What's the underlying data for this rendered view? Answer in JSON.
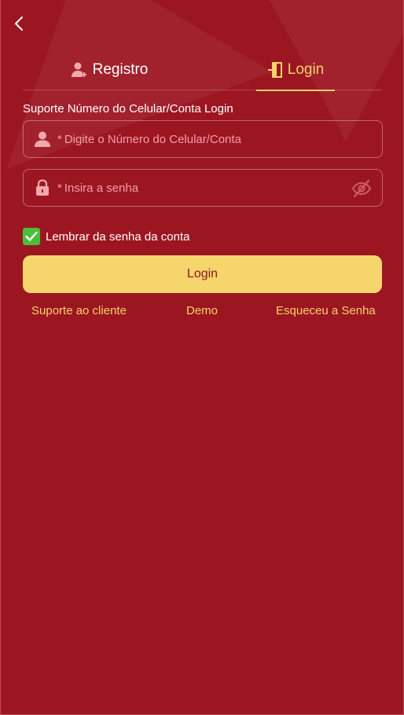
{
  "tabs": {
    "register_label": "Registro",
    "login_label": "Login"
  },
  "form": {
    "account_label": "Suporte Número do Celular/Conta Login",
    "required_mark": "*",
    "phone_placeholder": "Digite o Número do Celular/Conta",
    "password_placeholder": "Insira a senha",
    "remember_label": "Lembrar da senha da conta",
    "remember_checked": true,
    "submit_label": "Login"
  },
  "links": {
    "support": "Suporte ao cliente",
    "demo": "Demo",
    "forgot": "Esqueceu a Senha"
  },
  "colors": {
    "background": "#9c1622",
    "accent": "#f5d36b",
    "button": "#f6d56d",
    "checkbox": "#4cbf3a",
    "placeholder": "#f0a0a6"
  },
  "icons": {
    "back": "chevron-left-icon",
    "register": "user-plus-icon",
    "login": "door-enter-icon",
    "phone_field": "user-icon",
    "password_field": "lock-icon",
    "visibility": "eye-off-icon",
    "checkbox": "checkmark-icon"
  }
}
